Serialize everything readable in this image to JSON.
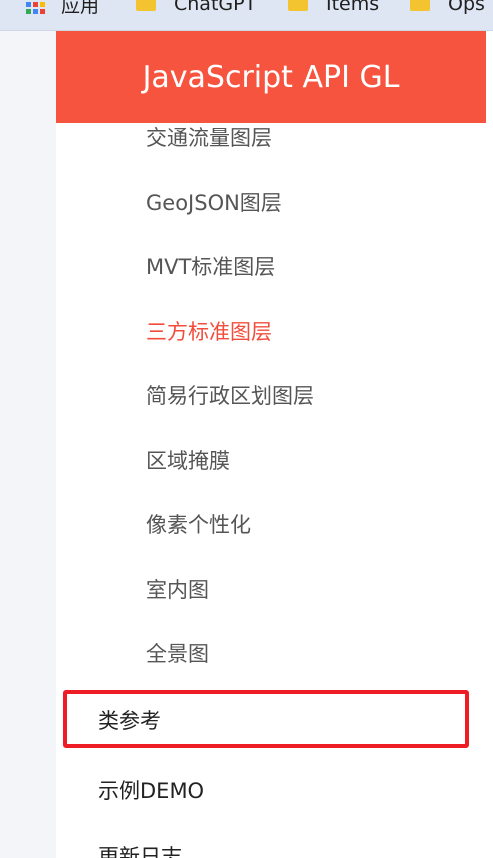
{
  "bookmarks": {
    "apps_label": "应用",
    "items": [
      "ChatGPT",
      "Items",
      "Ops"
    ],
    "apps_colors": [
      "#ea4335",
      "#fbbc05",
      "#34a853",
      "#4285f4",
      "#ea4335",
      "#fbbc05",
      "#34a853",
      "#4285f4",
      "#ea4335"
    ]
  },
  "nav": {
    "title": "JavaScript API GL",
    "accent_color": "#f75440",
    "active_color": "#f24d3c",
    "sub_items": [
      "交通流量图层",
      "GeoJSON图层",
      "MVT标准图层",
      "三方标准图层",
      "简易行政区划图层",
      "区域掩膜",
      "像素个性化",
      "室内图",
      "全景图"
    ],
    "active_item": "三方标准图层",
    "sections": [
      "类参考",
      "示例DEMO",
      "更新日志"
    ],
    "highlighted_section": "类参考",
    "highlight_color": "#ee1c25"
  }
}
